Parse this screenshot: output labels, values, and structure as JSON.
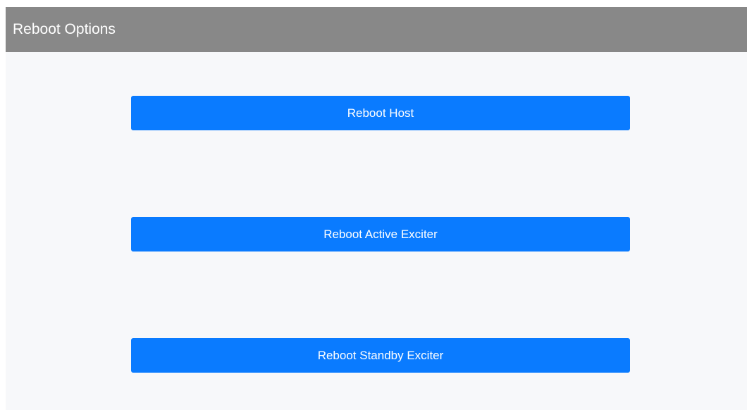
{
  "header": {
    "title": "Reboot Options"
  },
  "buttons": [
    {
      "label": "Reboot Host"
    },
    {
      "label": "Reboot Active Exciter"
    },
    {
      "label": "Reboot Standby Exciter"
    }
  ],
  "colors": {
    "header_bg": "#888888",
    "panel_bg": "#f7f8fa",
    "button_bg": "#0a7bff",
    "button_text": "#ffffff"
  }
}
